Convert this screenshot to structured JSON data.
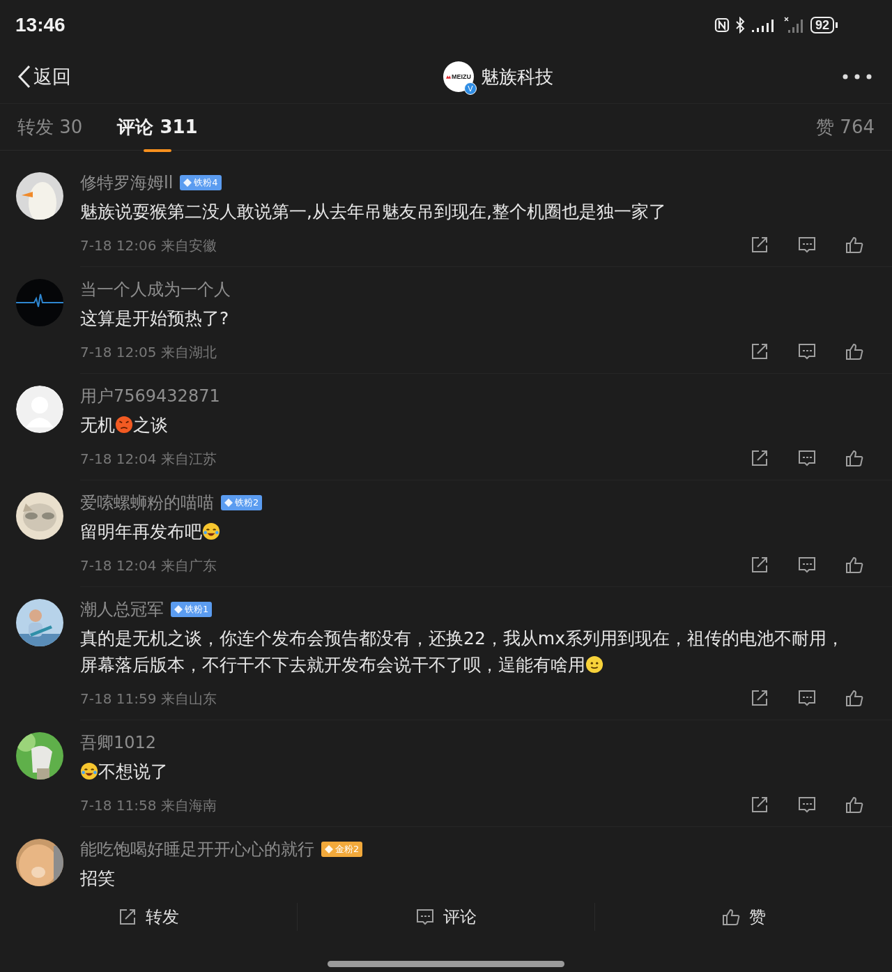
{
  "status_bar": {
    "time": "13:46",
    "battery": "92"
  },
  "nav": {
    "back": "返回",
    "account": {
      "logo_text": "MEIZU",
      "verified": "V",
      "name": "魅族科技"
    }
  },
  "tabs": [
    {
      "label": "转发 30",
      "selected": false
    },
    {
      "label": "评论 311",
      "selected": true
    },
    {
      "label": "赞 764",
      "selected": false
    }
  ],
  "comments": [
    {
      "avatar": {
        "kind": "picture"
      },
      "name": "修特罗海姆ll",
      "badge": {
        "label": "铁粉4",
        "color": "#5b9cf0"
      },
      "content": [
        {
          "kind": "text",
          "text": "魅族说耍猴第二没人敢说第一,从去年吊魅友吊到现在,整个机圈也是独一家了"
        }
      ],
      "meta": "7-18 12:06 来自安徽"
    },
    {
      "avatar": {
        "kind": "picture"
      },
      "name": "当一个人成为一个人",
      "content": [
        {
          "kind": "text",
          "text": "这算是开始预热了?"
        }
      ],
      "meta": "7-18 12:05 来自湖北"
    },
    {
      "avatar": {
        "kind": "default"
      },
      "name": "用户7569432871",
      "content": [
        {
          "kind": "text",
          "text": "无机"
        },
        {
          "kind": "angry-emoji"
        },
        {
          "kind": "text",
          "text": "之谈"
        }
      ],
      "meta": "7-18 12:04 来自江苏"
    },
    {
      "avatar": {
        "kind": "picture"
      },
      "name": "爱嗦螺蛳粉的喵喵",
      "badge": {
        "label": "铁粉2",
        "color": "#5b9cf0"
      },
      "content": [
        {
          "kind": "text",
          "text": "留明年再发布吧"
        },
        {
          "kind": "laugh-emoji"
        }
      ],
      "meta": "7-18 12:04 来自广东"
    },
    {
      "avatar": {
        "kind": "picture"
      },
      "name": "潮人总冠军",
      "badge": {
        "label": "铁粉1",
        "color": "#5b9cf0"
      },
      "content": [
        {
          "kind": "text",
          "text": "真的是无机之谈，你连个发布会预告都没有，还换22，我从mx系列用到现在，祖传的电池不耐用，屏幕落后版本，不行干不下去就开发布会说干不了呗，逞能有啥用"
        },
        {
          "kind": "smile-emoji"
        }
      ],
      "meta": "7-18 11:59 来自山东"
    },
    {
      "avatar": {
        "kind": "picture"
      },
      "name": "吾卿1012",
      "content": [
        {
          "kind": "laugh-emoji"
        },
        {
          "kind": "text",
          "text": "不想说了"
        }
      ],
      "meta": "7-18 11:58 来自海南"
    },
    {
      "avatar": {
        "kind": "picture"
      },
      "name": "能吃饱喝好睡足开开心心的就行",
      "badge": {
        "label": "金粉2",
        "color": "#f2a93b"
      },
      "content": [
        {
          "kind": "text",
          "text": "招笑"
        }
      ]
    }
  ],
  "bottom_bar": [
    {
      "kind": "repost",
      "label": "转发"
    },
    {
      "kind": "comment",
      "label": "评论"
    },
    {
      "kind": "like",
      "label": "赞"
    }
  ]
}
